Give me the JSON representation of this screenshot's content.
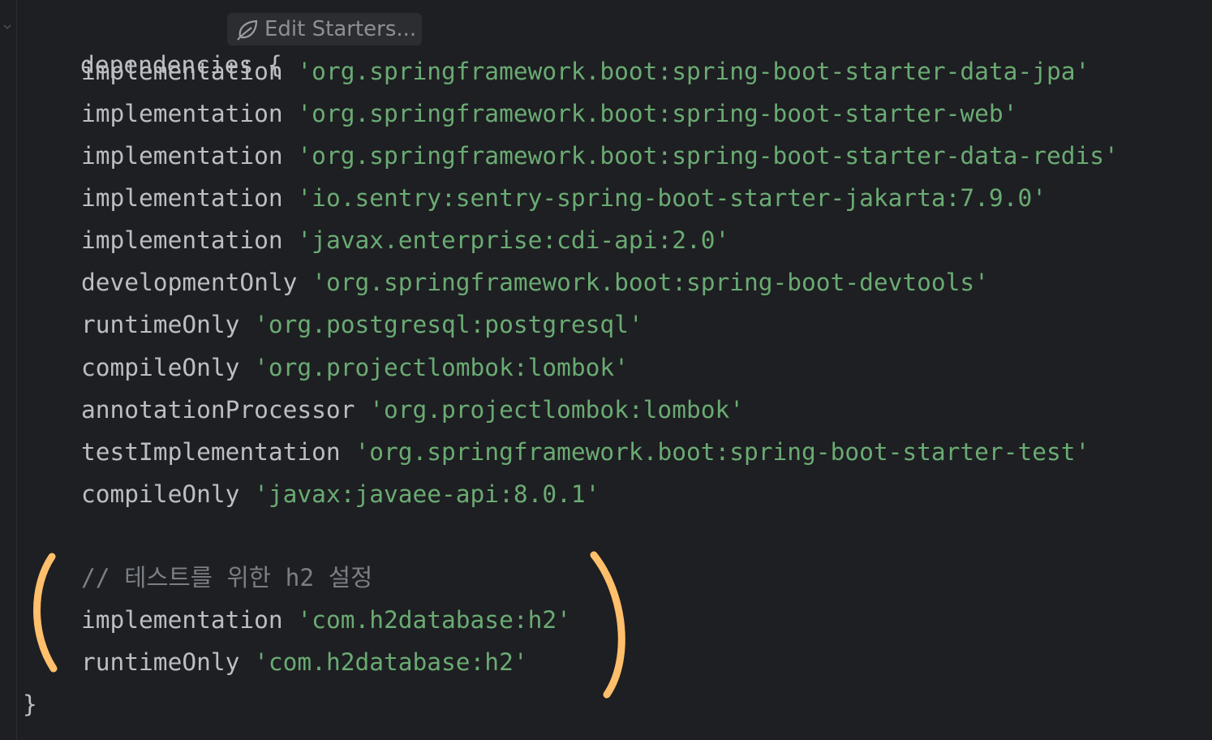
{
  "editor": {
    "inlay_hint": {
      "label": "Edit Starters...",
      "icon": "spring-leaf-icon"
    },
    "lines": {
      "open": {
        "keyword": "dependencies",
        "brace": "{"
      },
      "dep1": {
        "config": "implementation",
        "artifact": "'org.springframework.boot:spring-boot-starter-data-jpa'"
      },
      "dep2": {
        "config": "implementation",
        "artifact": "'org.springframework.boot:spring-boot-starter-web'"
      },
      "dep3": {
        "config": "implementation",
        "artifact": "'org.springframework.boot:spring-boot-starter-data-redis'"
      },
      "dep4": {
        "config": "implementation",
        "artifact": "'io.sentry:sentry-spring-boot-starter-jakarta:7.9.0'"
      },
      "dep5": {
        "config": "implementation",
        "artifact": "'javax.enterprise:cdi-api:2.0'"
      },
      "dep6": {
        "config": "developmentOnly",
        "artifact": "'org.springframework.boot:spring-boot-devtools'"
      },
      "dep7": {
        "config": "runtimeOnly",
        "artifact": "'org.postgresql:postgresql'"
      },
      "dep8": {
        "config": "compileOnly",
        "artifact": "'org.projectlombok:lombok'"
      },
      "dep9": {
        "config": "annotationProcessor",
        "artifact": "'org.projectlombok:lombok'"
      },
      "dep10": {
        "config": "testImplementation",
        "artifact": "'org.springframework.boot:spring-boot-starter-test'"
      },
      "dep11": {
        "config": "compileOnly",
        "artifact": "'javax:javaee-api:8.0.1'"
      },
      "comment": "// 테스트를 위한 h2 설정",
      "dep12": {
        "config": "implementation",
        "artifact": "'com.h2database:h2'"
      },
      "dep13": {
        "config": "runtimeOnly",
        "artifact": "'com.h2database:h2'"
      },
      "close": {
        "brace": "}"
      }
    }
  },
  "colors": {
    "background": "#1e1f22",
    "default_text": "#bcbec4",
    "string": "#6aab73",
    "comment": "#7a7e85",
    "annotation_paren": "#ffbf6b"
  }
}
